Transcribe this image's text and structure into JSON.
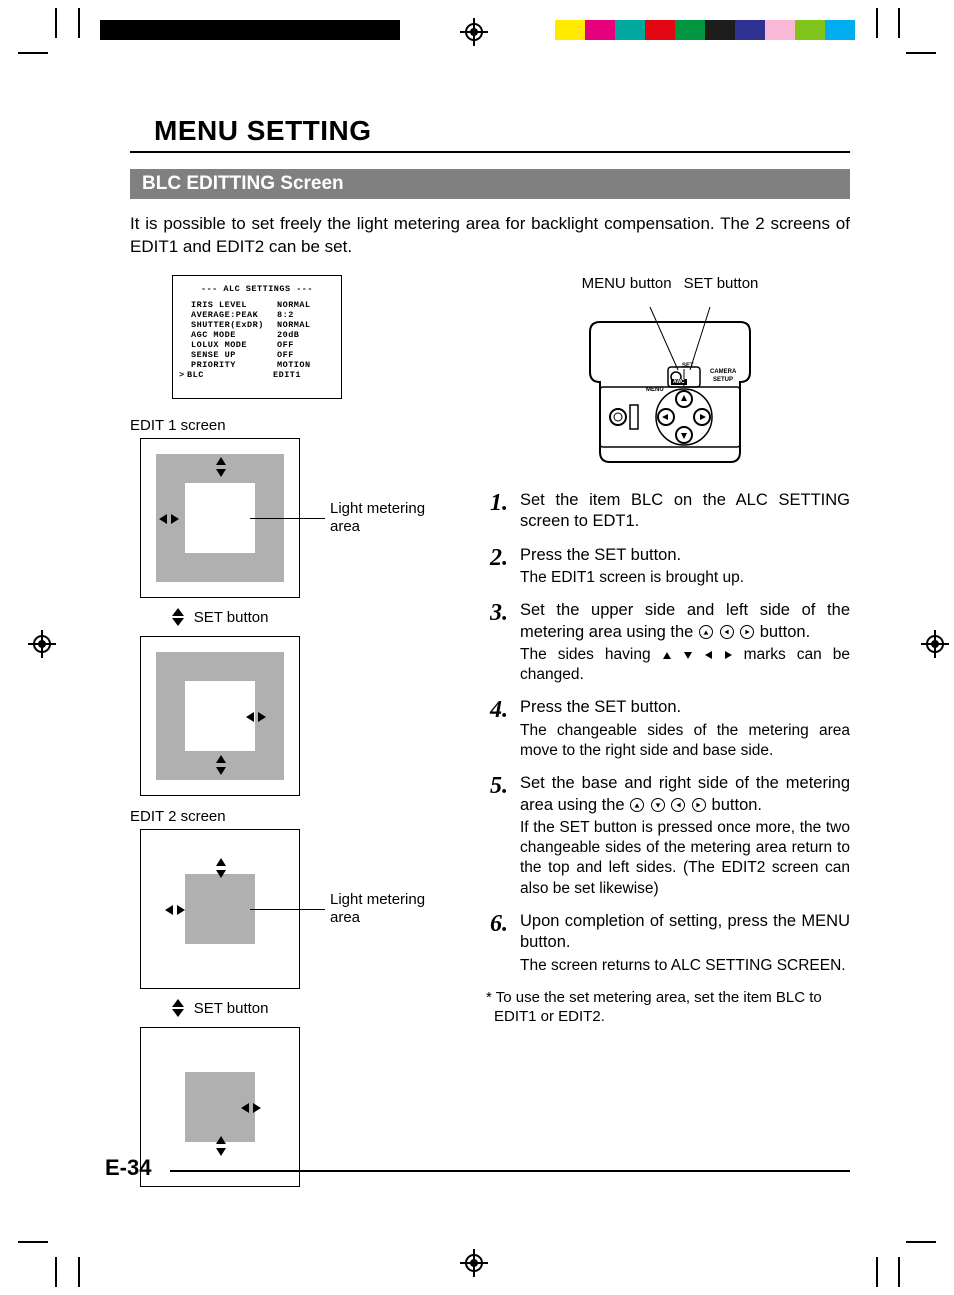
{
  "header": {
    "title": "MENU SETTING",
    "section": "BLC EDITTING Screen"
  },
  "intro": "It is possible to set freely the light metering area for backlight compensation.  The 2 screens of EDIT1 and EDIT2 can be set.",
  "alc": {
    "title": "--- ALC SETTINGS ---",
    "rows": [
      {
        "key": "IRIS LEVEL",
        "val": "NORMAL"
      },
      {
        "key": "AVERAGE:PEAK",
        "val": "8:2"
      },
      {
        "key": "SHUTTER(ExDR)",
        "val": "NORMAL"
      },
      {
        "key": "AGC MODE",
        "val": "20dB"
      },
      {
        "key": "LOLUX MODE",
        "val": "OFF"
      },
      {
        "key": "SENSE UP",
        "val": "OFF"
      },
      {
        "key": "PRIORITY",
        "val": "MOTION"
      },
      {
        "key": "BLC",
        "val": "EDIT1",
        "cursor": ">"
      }
    ]
  },
  "labels": {
    "edit1": "EDIT 1 screen",
    "edit2": "EDIT 2 screen",
    "light_metering": "Light metering area",
    "set_button": "SET button",
    "cp_menu": "MENU button",
    "cp_set": "SET button",
    "cp_tag_set": "SET",
    "cp_tag_menu": "MENU",
    "cp_tag_awc": "AWC",
    "cp_tag_camera": "CAMERA",
    "cp_tag_setup": "SETUP"
  },
  "steps": [
    {
      "n": "1.",
      "main": "Set the item BLC on the ALC SETTING screen to EDT1.",
      "sub": ""
    },
    {
      "n": "2.",
      "main": "Press the SET button.",
      "sub": "The EDIT1 screen is brought up."
    },
    {
      "n": "3.",
      "main_a": "Set the upper side and left side of the metering area using the ",
      "main_b": " button.",
      "sub_a": "The sides having ",
      "sub_b": " marks can be changed."
    },
    {
      "n": "4.",
      "main": "Press the SET button.",
      "sub": "The changeable sides of the metering area move to the right side and base side."
    },
    {
      "n": "5.",
      "main_a": "Set the base and right side of the metering area using the ",
      "main_b": " button.",
      "sub": "If the SET button is pressed once more, the two changeable sides of the metering area return to the top and left sides. (The EDIT2 screen can also be set likewise)"
    },
    {
      "n": "6.",
      "main": "Upon completion of setting, press the MENU button.",
      "sub": "The screen returns to ALC SETTING SCREEN."
    }
  ],
  "footnote": "* To use the set metering area, set the item BLC to EDIT1 or EDIT2.",
  "page_num": "E-34",
  "colors": {
    "bars": [
      "#ffea00",
      "#e6007e",
      "#00a99d",
      "#e30613",
      "#009640",
      "#1d1d1b",
      "#2e3192",
      "#f9b8d5",
      "#80c41c",
      "#00aeef"
    ]
  }
}
